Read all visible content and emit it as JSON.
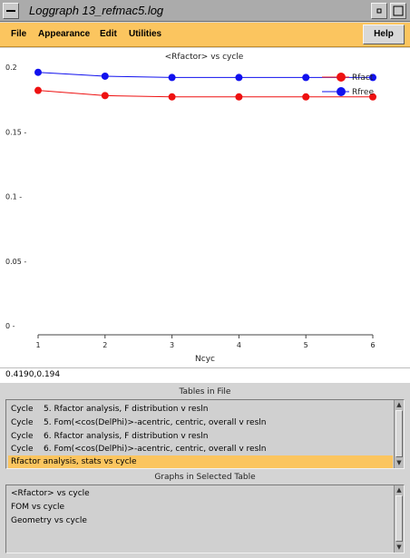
{
  "window": {
    "title": "Loggraph 13_refmac5.log",
    "menu_icon": "window-menu-icon",
    "minimize_glyph": "▫",
    "maximize_glyph": "□"
  },
  "menu": {
    "file": "File",
    "appearance": "Appearance",
    "edit": "Edit",
    "utilities": "Utilities",
    "help": "Help"
  },
  "chart_data": {
    "type": "line",
    "title": "<Rfactor> vs cycle",
    "xlabel": "Ncyc",
    "ylabel": "",
    "x": [
      1,
      2,
      3,
      4,
      5,
      6
    ],
    "xlim": [
      1,
      6
    ],
    "ylim": [
      0,
      0.2
    ],
    "xticks": [
      "1",
      "2",
      "3",
      "4",
      "5",
      "6"
    ],
    "yticks": [
      {
        "value": 0,
        "label": "0 -"
      },
      {
        "value": 0.05,
        "label": "0.05 -"
      },
      {
        "value": 0.1,
        "label": "0.1 -"
      },
      {
        "value": 0.15,
        "label": "0.15 -"
      },
      {
        "value": 0.2,
        "label": "0.2"
      }
    ],
    "legend_position": "top-right",
    "series": [
      {
        "name": "Rfact",
        "color": "#ee1111",
        "values": [
          0.182,
          0.178,
          0.177,
          0.177,
          0.177,
          0.177
        ]
      },
      {
        "name": "Rfree",
        "color": "#1111ee",
        "values": [
          0.196,
          0.193,
          0.192,
          0.192,
          0.192,
          0.192
        ]
      }
    ]
  },
  "coords": {
    "text": "0.4190,0.194"
  },
  "tables_section": {
    "title": "Tables in File",
    "items": [
      "Cycle    5. Rfactor analysis, F distribution v resln",
      "Cycle    5. Fom(<cos(DelPhi)>-acentric, centric, overall v resln",
      "Cycle    6. Rfactor analysis, F distribution v resln",
      "Cycle    6. Fom(<cos(DelPhi)>-acentric, centric, overall v resln",
      "Rfactor analysis, stats vs cycle"
    ]
  },
  "graphs_section": {
    "title": "Graphs in Selected Table",
    "items": [
      "<Rfactor> vs cycle",
      "FOM vs cycle",
      "Geometry vs cycle"
    ]
  },
  "colors": {
    "menu_bg": "#fbc55f",
    "selected_bg": "#fbc55f",
    "rfact": "#ee1111",
    "rfree": "#1111ee"
  }
}
